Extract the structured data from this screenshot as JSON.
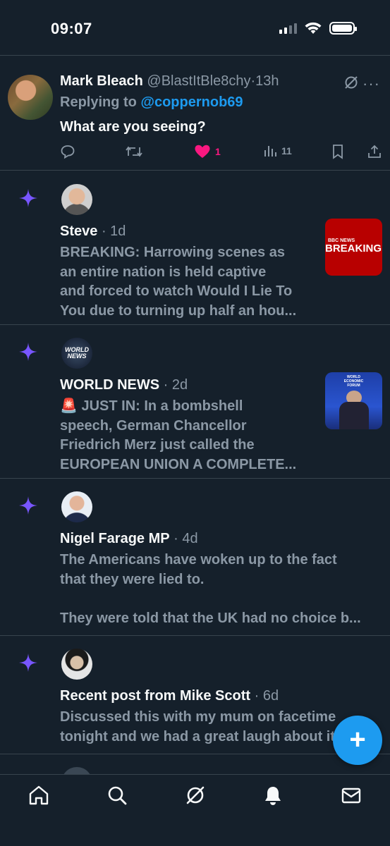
{
  "status_bar": {
    "time": "09:07"
  },
  "reply_tweet": {
    "display_name": "Mark Bleach",
    "handle": "@BlastItBle8chy",
    "separator": "·",
    "age": "13h",
    "replying_prefix": "Replying to",
    "replying_to": "@coppernob69",
    "text": "What are you seeing?",
    "likes": "1",
    "views": "11"
  },
  "notifications": [
    {
      "display_name": "Steve",
      "age": "1d",
      "lines": [
        "BREAKING: Harrowing scenes as",
        "an entire nation is held captive",
        "and forced to watch Would I Lie To",
        "You due to turning up half an hou..."
      ],
      "thumb_label_top": "BBC NEWS",
      "thumb_label_main": "BREAKING"
    },
    {
      "display_name": "WORLD NEWS",
      "age": "2d",
      "lines": [
        "🚨 JUST IN: In a bombshell",
        "speech, German Chancellor",
        "Friedrich Merz just called the",
        "EUROPEAN UNION A COMPLETE..."
      ],
      "avatar_text_1": "WORLD",
      "avatar_text_2": "NEWS",
      "thumb_label": "WORLD ECONOMIC FORUM"
    },
    {
      "display_name": "Nigel Farage MP",
      "age": "4d",
      "lines": [
        "The Americans have woken up to the fact",
        "that they were lied to.",
        "",
        "They were told that the UK had no choice b..."
      ]
    },
    {
      "display_name": "Recent post from Mike Scott",
      "age": "6d",
      "lines": [
        "Discussed this with my mum on facetime",
        "tonight and we had a great laugh about it"
      ]
    }
  ],
  "fab": {
    "label": "+"
  },
  "bottom_nav": [
    "home-icon",
    "search-icon",
    "grok-icon",
    "notifications-icon",
    "messages-icon"
  ],
  "colors": {
    "background": "#15202b",
    "accent": "#1d9bf0",
    "like": "#f91880",
    "sparkle": "#7856ff",
    "muted": "#8b98a5"
  }
}
